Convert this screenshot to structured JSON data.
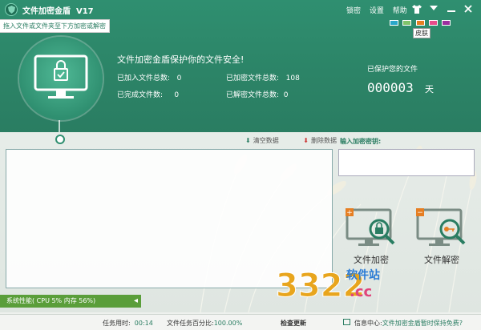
{
  "app": {
    "title": "文件加密金盾",
    "version": "V17"
  },
  "titlebar": {
    "links": [
      "锁密",
      "设置",
      "帮助"
    ],
    "skin_label": "皮肤"
  },
  "swatches": [
    "#2aa7c9",
    "#7fc36a",
    "#3a7bd5",
    "#e67e22",
    "#e84c8b",
    "#9b2f9e"
  ],
  "hint": "拖入文件或文件夹至下方加密或解密",
  "headline": "文件加密金盾保护你的文件安全!",
  "stats": [
    {
      "label": "已加入文件总数:",
      "value": "0"
    },
    {
      "label": "已加密文件总数:",
      "value": "108"
    },
    {
      "label": "已完成文件数:",
      "value": "0"
    },
    {
      "label": "已解密文件总数:",
      "value": "0"
    }
  ],
  "protected": {
    "label": "已保护您的文件",
    "days": "000003",
    "unit": "天"
  },
  "actions": {
    "clear": "清空数据",
    "delete": "删除数据"
  },
  "key": {
    "label": "输入加密密钥:",
    "value": ""
  },
  "buttons": {
    "encrypt": "文件加密",
    "decrypt": "文件解密"
  },
  "performance": {
    "text": "系统性能( CPU 5%    内存 56%)"
  },
  "watermark": {
    "brand": "3322",
    "site": "软件站",
    "domain": ".cc"
  },
  "statusbar": {
    "time_label": "任务用时:",
    "time_value": "00:14",
    "progress_label": "文件任务百分比:",
    "progress_value": "100.00%",
    "update": "检查更新",
    "info_label": "信息中心:",
    "info_link": "文件加密金盾暂时保持免费?"
  },
  "colors": {
    "brand": "#2f8f70",
    "accent": "#2a7d62",
    "perf": "#5a9e3a"
  }
}
